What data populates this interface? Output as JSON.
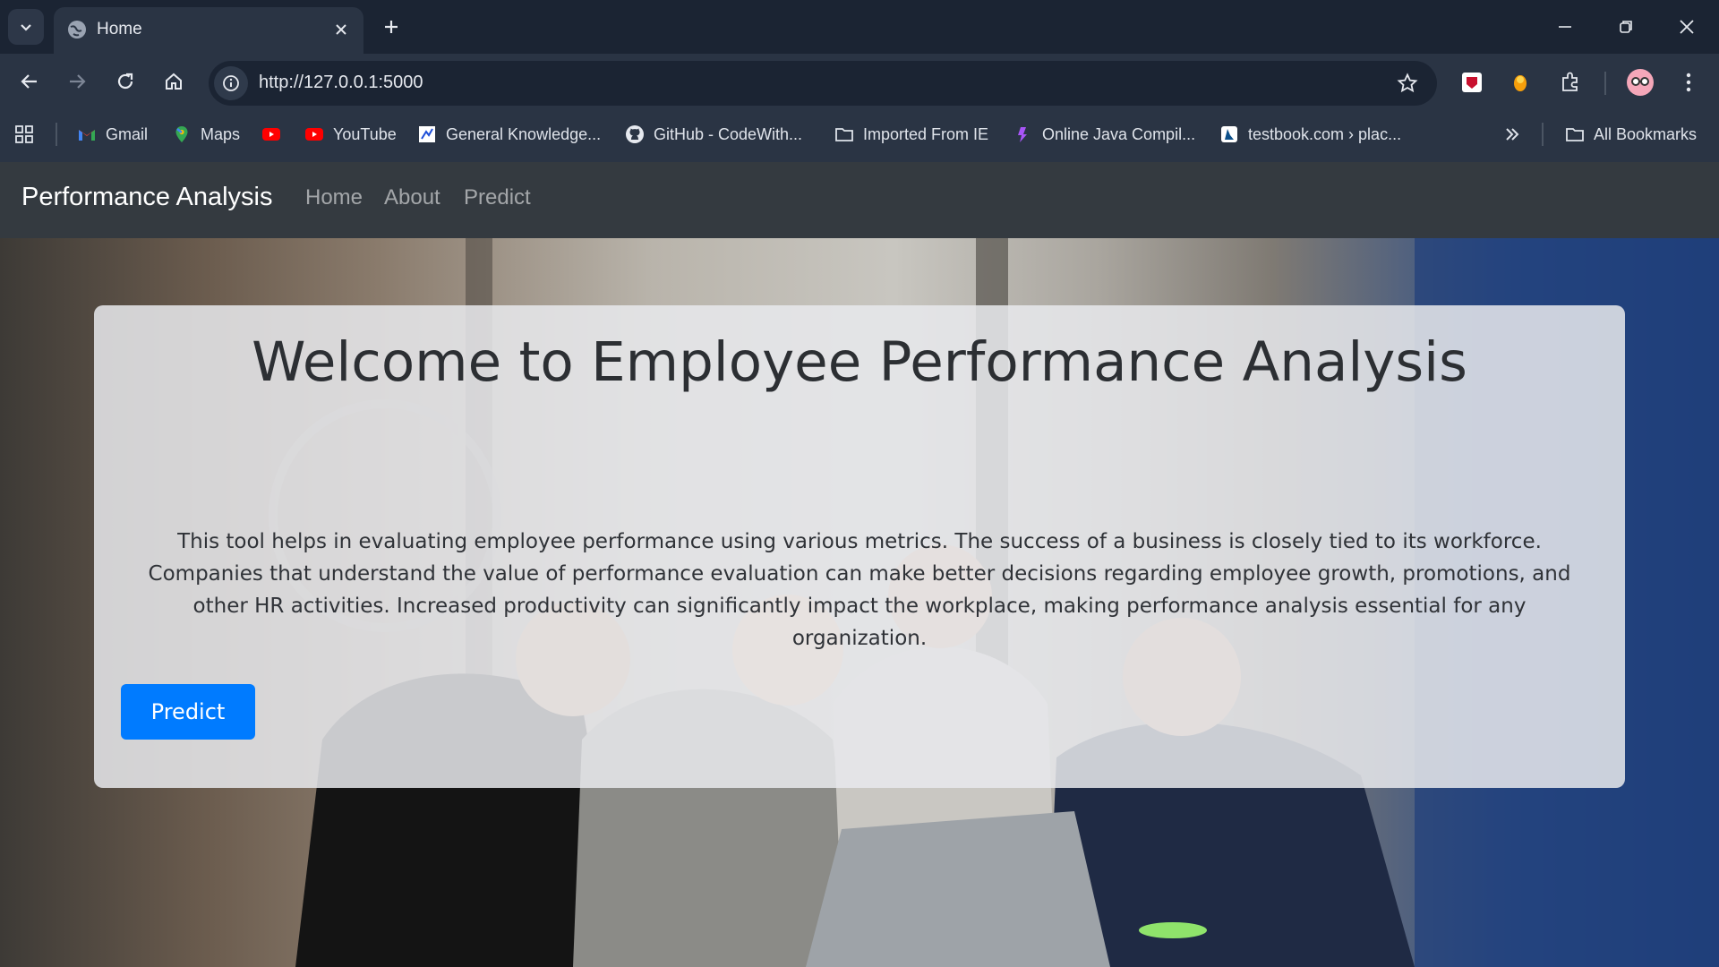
{
  "browser": {
    "tab": {
      "title": "Home"
    },
    "url": "http://127.0.0.1:5000",
    "bookmarks": [
      {
        "label": "Gmail",
        "icon": "gmail-icon"
      },
      {
        "label": "Maps",
        "icon": "maps-icon"
      },
      {
        "label": "",
        "icon": "youtube-icon"
      },
      {
        "label": "YouTube",
        "icon": "youtube-icon"
      },
      {
        "label": "General Knowledge...",
        "icon": "site-icon"
      },
      {
        "label": "GitHub - CodeWith...",
        "icon": "github-icon"
      },
      {
        "label": "Imported From IE",
        "icon": "folder-icon"
      },
      {
        "label": "Online Java Compil...",
        "icon": "site-icon"
      },
      {
        "label": "testbook.com › plac...",
        "icon": "site-icon"
      }
    ],
    "all_bookmarks": "All Bookmarks"
  },
  "page": {
    "brand": "Performance Analysis",
    "nav": [
      "Home",
      "About",
      "Predict"
    ],
    "hero": {
      "title": "Welcome to Employee Performance Analysis",
      "text": "This tool helps in evaluating employee performance using various metrics. The success of a business is closely tied to its workforce. Companies that understand the value of performance evaluation can make better decisions regarding employee growth, promotions, and other HR activities. Increased productivity can significantly impact the workplace, making performance analysis essential for any organization.",
      "button": "Predict"
    }
  },
  "colors": {
    "primary_button": "#007bff",
    "navbar": "#343a40"
  }
}
